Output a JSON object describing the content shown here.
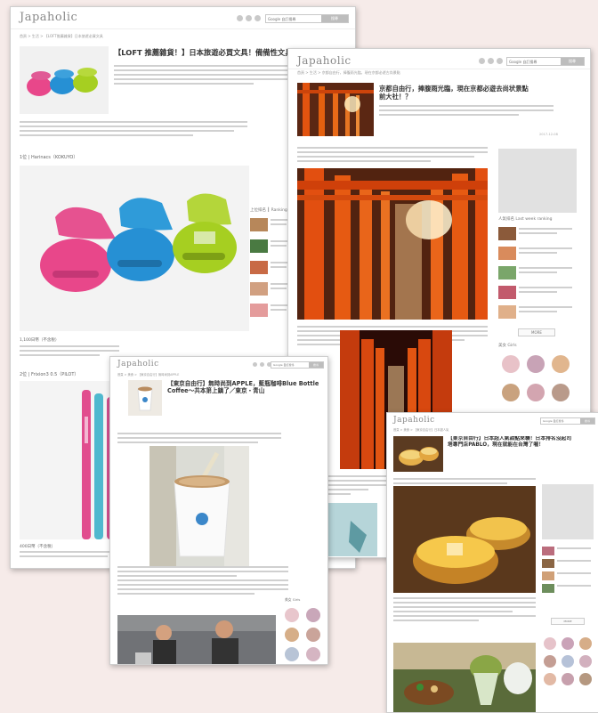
{
  "site": {
    "logo": "Japaholic",
    "search_placeholder": "Google 自訂搜尋",
    "search_button": "搜尋"
  },
  "articles": [
    {
      "breadcrumb": "首頁 > 生活 > 【LOFT推薦雜貨】日本旅遊必買文具",
      "title": "【LOFT 推薦雜貨！】日本旅遊必買文具！備備性文具人",
      "caption1": "1位 | Harinacs（KOKUYO）",
      "caption2": "2位 | Frixion3 0.5（PILOT）",
      "price1": "1,100日幣（不含稅）",
      "price2": "400日幣（不含稅）",
      "sidebar_heading": "上位排名 ┃ Ranking"
    },
    {
      "breadcrumb": "首頁 > 生活 > 京都自由行，捧腹雨光臨，現在京都必遊古尚景點",
      "title": "京都自由行，捧腹雨光臨，現在京都必遊去尚状景點前大社！？",
      "date": "2017-12-08",
      "sidebar_heading": "人氣排名 Last week ranking",
      "more_button": "MORE",
      "cute_heading": "美女 Girls"
    },
    {
      "breadcrumb": "首頁 > 美食 > 【東京自由行】無時尚到APPLE",
      "title": "【東京自由行】無時尚到APPLE，藍瓶咖啡Blue Bottle Coffee～共本第上鎮了／東京・青山"
    },
    {
      "breadcrumb": "首頁 > 美食 > 【東京自由行】日本超人氣",
      "title": "【東京自由行】日本超人氣甜點來襲！日本排名沒起司塔專門店PABLO，現在就能在台灣了喔！",
      "more_button": "MORE"
    }
  ],
  "icons": [
    "facebook-icon",
    "twitter-icon",
    "instagram-icon"
  ]
}
